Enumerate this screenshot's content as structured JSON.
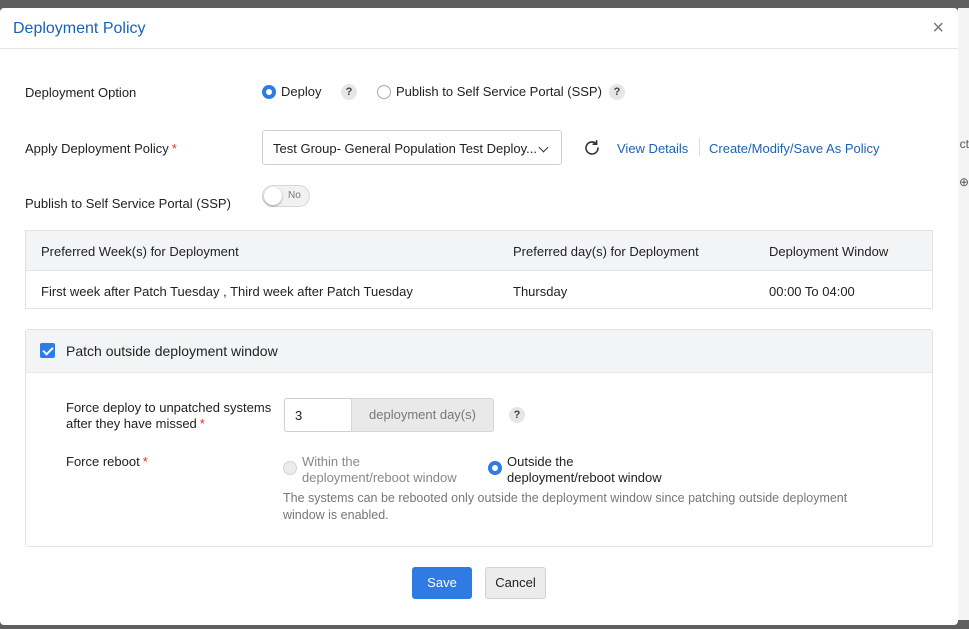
{
  "background": {
    "fragment_1": "ct",
    "fragment_2": "⊕"
  },
  "modal": {
    "title": "Deployment Policy",
    "close_glyph": "×"
  },
  "deployment_option": {
    "label": "Deployment Option",
    "options": [
      {
        "label": "Deploy",
        "selected": true
      },
      {
        "label": "Publish to Self Service Portal (SSP)",
        "selected": false
      }
    ],
    "help_glyph": "?"
  },
  "apply_policy": {
    "label": "Apply Deployment Policy",
    "required_mark": "*",
    "selected_value": "Test Group- General Population Test Deploy...",
    "view_details": "View Details",
    "create_modify": "Create/Modify/Save As Policy"
  },
  "publish_ssp": {
    "label": "Publish to Self Service Portal (SSP)",
    "toggle_text": "No",
    "enabled": false
  },
  "schedule_table": {
    "columns": [
      "Preferred Week(s) for Deployment",
      "Preferred day(s) for Deployment",
      "Deployment Window"
    ],
    "rows": [
      [
        "First week after Patch Tuesday , Third week after Patch Tuesday",
        "Thursday",
        "00:00 To 04:00"
      ]
    ]
  },
  "patch_outside": {
    "label": "Patch outside deployment window",
    "checked": true,
    "force_deploy": {
      "label_line1": "Force deploy to unpatched systems",
      "label_line2": "after they have missed",
      "required_mark": "*",
      "value": "3",
      "unit": "deployment day(s)"
    },
    "force_reboot": {
      "label": "Force reboot",
      "required_mark": "*",
      "options": [
        {
          "line1": "Within the",
          "line2": "deployment/reboot window",
          "selected": false,
          "disabled": true
        },
        {
          "line1": "Outside the",
          "line2": "deployment/reboot window",
          "selected": true,
          "disabled": false
        }
      ],
      "note": "The systems can be rebooted only outside the deployment window since patching outside deployment window is enabled."
    }
  },
  "footer": {
    "save": "Save",
    "cancel": "Cancel"
  },
  "colors": {
    "accent": "#2d7be3",
    "title": "#1a62b7",
    "required": "#e0332b"
  }
}
